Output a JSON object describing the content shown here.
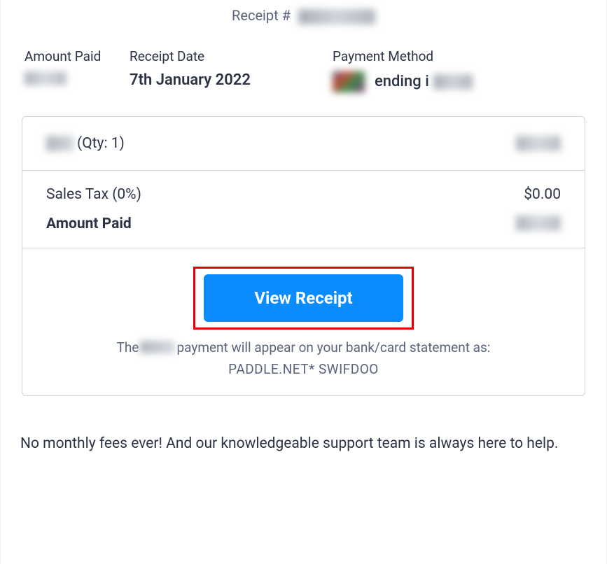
{
  "header": {
    "receipt_label": "Receipt #"
  },
  "summary": {
    "amount_label": "Amount Paid",
    "date_label": "Receipt Date",
    "date_value": "7th January 2022",
    "method_label": "Payment Method",
    "method_text": "ending i"
  },
  "items": {
    "qty_text": "(Qty: 1)"
  },
  "totals": {
    "sales_tax_label": "Sales Tax (0%)",
    "sales_tax_value": "$0.00",
    "amount_paid_label": "Amount Paid"
  },
  "action": {
    "view_receipt_label": "View Receipt"
  },
  "statement": {
    "prefix": "The",
    "suffix": "payment will appear on your bank/card statement as:",
    "descriptor": "PADDLE.NET* SWIFDOO"
  },
  "footer": {
    "text": "No monthly fees ever! And our knowledgeable support team is always here to help."
  }
}
